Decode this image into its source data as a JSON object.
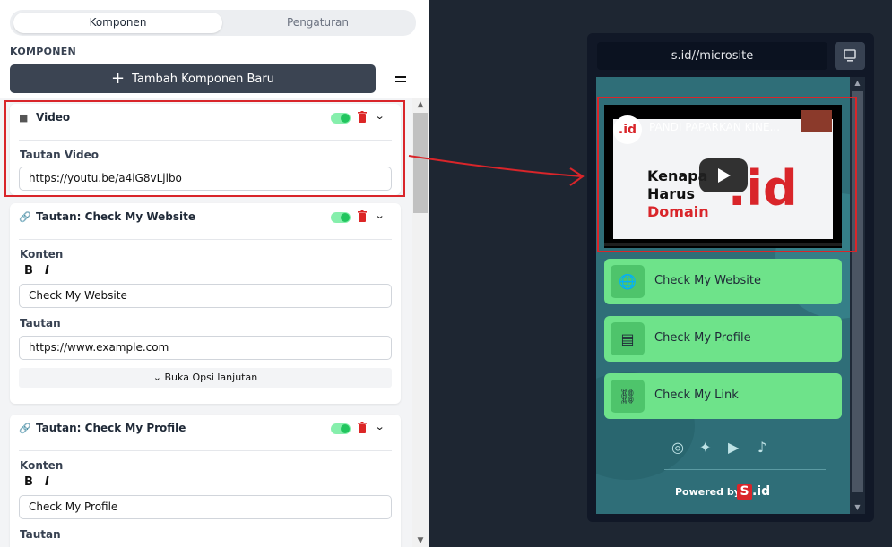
{
  "left_panel": {
    "tabs": [
      {
        "label": "Komponen",
        "active": true
      },
      {
        "label": "Pengaturan",
        "active": false
      }
    ],
    "section_label": "KOMPONEN",
    "add_button_label": "Tambah Komponen Baru",
    "add_button_icon": "plus-icon",
    "menu_icon": "menu-icon",
    "cards": [
      {
        "icon": "video-camera-icon",
        "title": "Video",
        "enabled": true,
        "fields": [
          {
            "label": "Tautan Video",
            "value": "https://youtu.be/a4iG8vLjlbo"
          }
        ]
      },
      {
        "icon": "link-icon",
        "title": "Tautan: Check My Website",
        "enabled": true,
        "konten_label": "Konten",
        "bold_label": "B",
        "italic_label": "I",
        "konten_value": "Check My Website",
        "tautan_label": "Tautan",
        "tautan_value": "https://www.example.com",
        "advanced_label": "Buka Opsi lanjutan"
      },
      {
        "icon": "link-icon",
        "title": "Tautan: Check My Profile",
        "enabled": true,
        "konten_label": "Konten",
        "bold_label": "B",
        "italic_label": "I",
        "konten_value": "Check My Profile",
        "tautan_label": "Tautan"
      }
    ]
  },
  "preview": {
    "url": "s.id//microsite",
    "device_icon": "desktop-icon",
    "video": {
      "channel_logo": ".id",
      "title": "PANDI PAPARKAN KINE...",
      "line1": "Kenapa",
      "line2": "Harus",
      "line3": "Domain",
      "big_text": ".id",
      "play_icon": "play-icon"
    },
    "links": [
      {
        "label": "Check My Website",
        "icon": "globe-icon"
      },
      {
        "label": "Check My Profile",
        "icon": "id-card-icon"
      },
      {
        "label": "Check My Link",
        "icon": "link-icon"
      }
    ],
    "social_icons": [
      "instagram-icon",
      "twitter-icon",
      "youtube-icon",
      "tiktok-icon"
    ],
    "powered_by": "Powered by",
    "brand_s": "S",
    "brand_id": ".id"
  },
  "colors": {
    "highlight": "#d9252a",
    "accent_green": "#6ee38a",
    "dark_bg": "#1e2632",
    "screen_bg": "#2f6e78"
  }
}
